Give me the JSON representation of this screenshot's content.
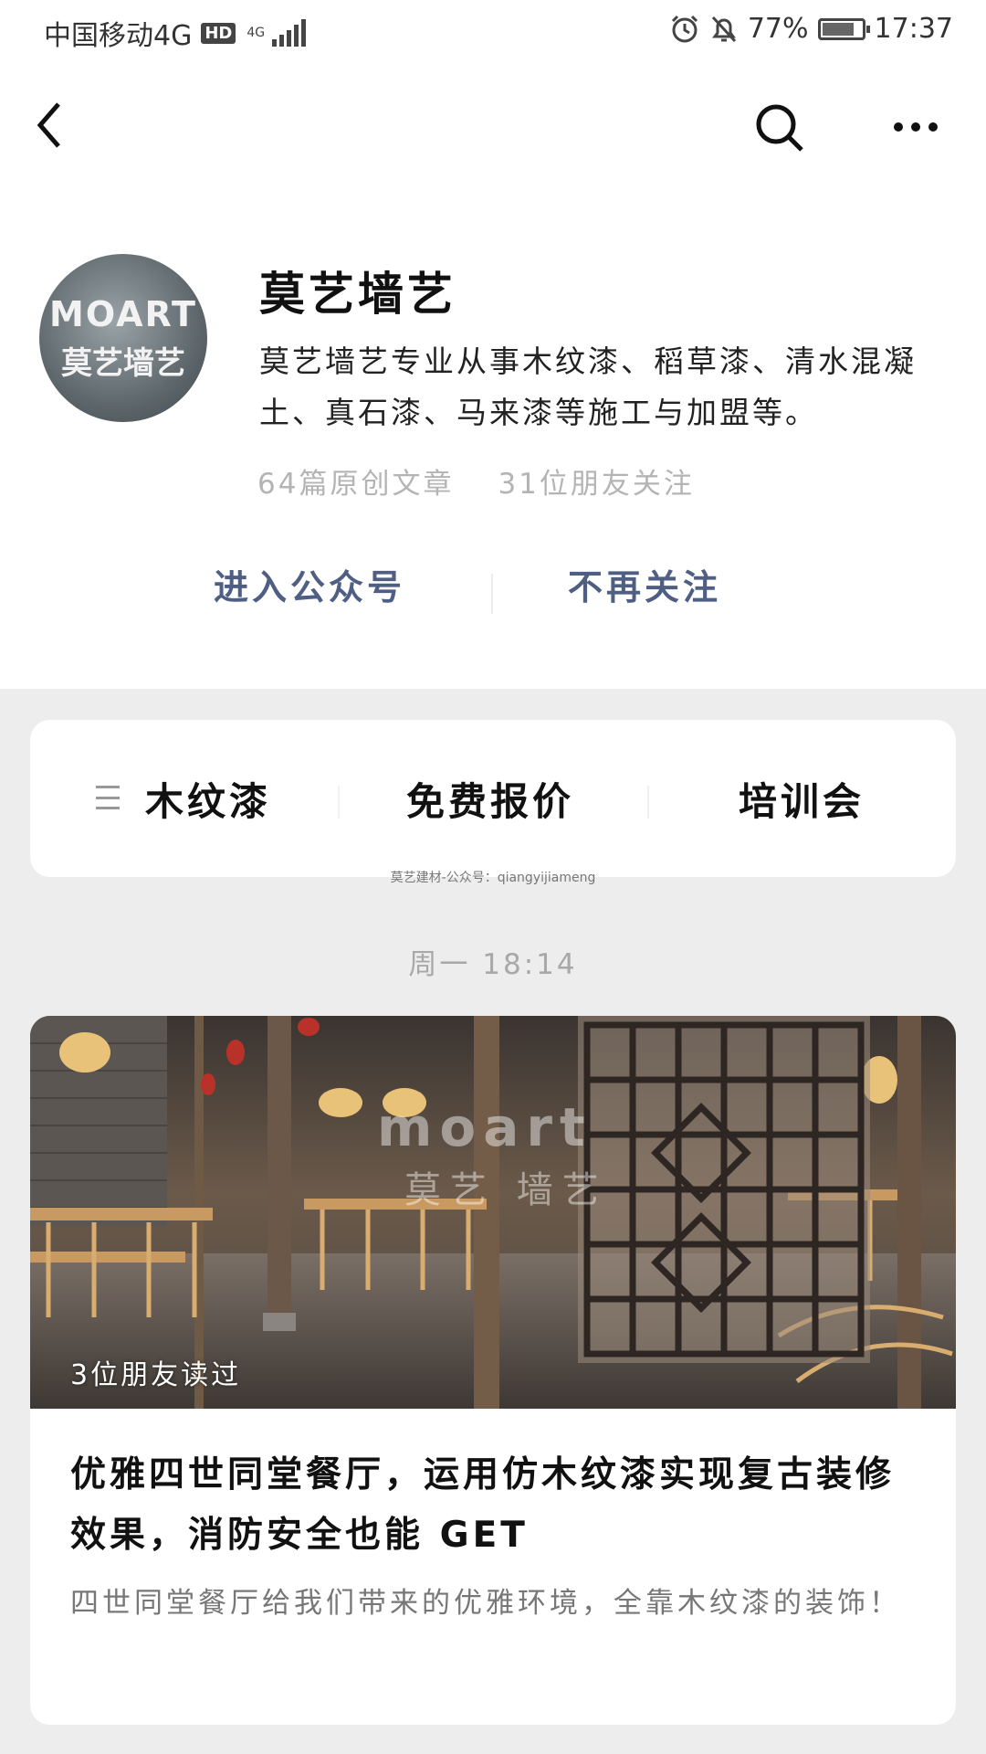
{
  "status_bar": {
    "carrier": "中国移动4G",
    "hd": "HD",
    "net": "4G",
    "battery": "77%",
    "time": "17:37"
  },
  "nav": {
    "back_icon": "back-arrow-icon",
    "search_icon": "search-icon",
    "more_icon": "more-icon"
  },
  "profile": {
    "avatar_text_1": "MOART",
    "avatar_text_2": "莫艺墙艺",
    "name": "莫艺墙艺",
    "description": "莫艺墙艺专业从事木纹漆、稻草漆、清水混凝土、真石漆、马来漆等施工与加盟等。",
    "articles": "64篇原创文章",
    "friends_following": "31位朋友关注",
    "enter_label": "进入公众号",
    "unfollow_label": "不再关注",
    "action_color": "#4f5f84"
  },
  "menu": {
    "items": [
      {
        "label": "木纹漆"
      },
      {
        "label": "免费报价"
      },
      {
        "label": "培训会"
      }
    ]
  },
  "watermark": "莫艺建材-公众号：qiangyijiameng",
  "feed": {
    "timestamp": "周一 18:14",
    "article": {
      "cover_mark_1": "moart",
      "cover_mark_2": "莫艺 墙艺",
      "read_by": "3位朋友读过",
      "title": "优雅四世同堂餐厅，运用仿木纹漆实现复古装修效果，消防安全也能 GET",
      "summary": "四世同堂餐厅给我们带来的优雅环境，全靠木纹漆的装饰！"
    }
  }
}
